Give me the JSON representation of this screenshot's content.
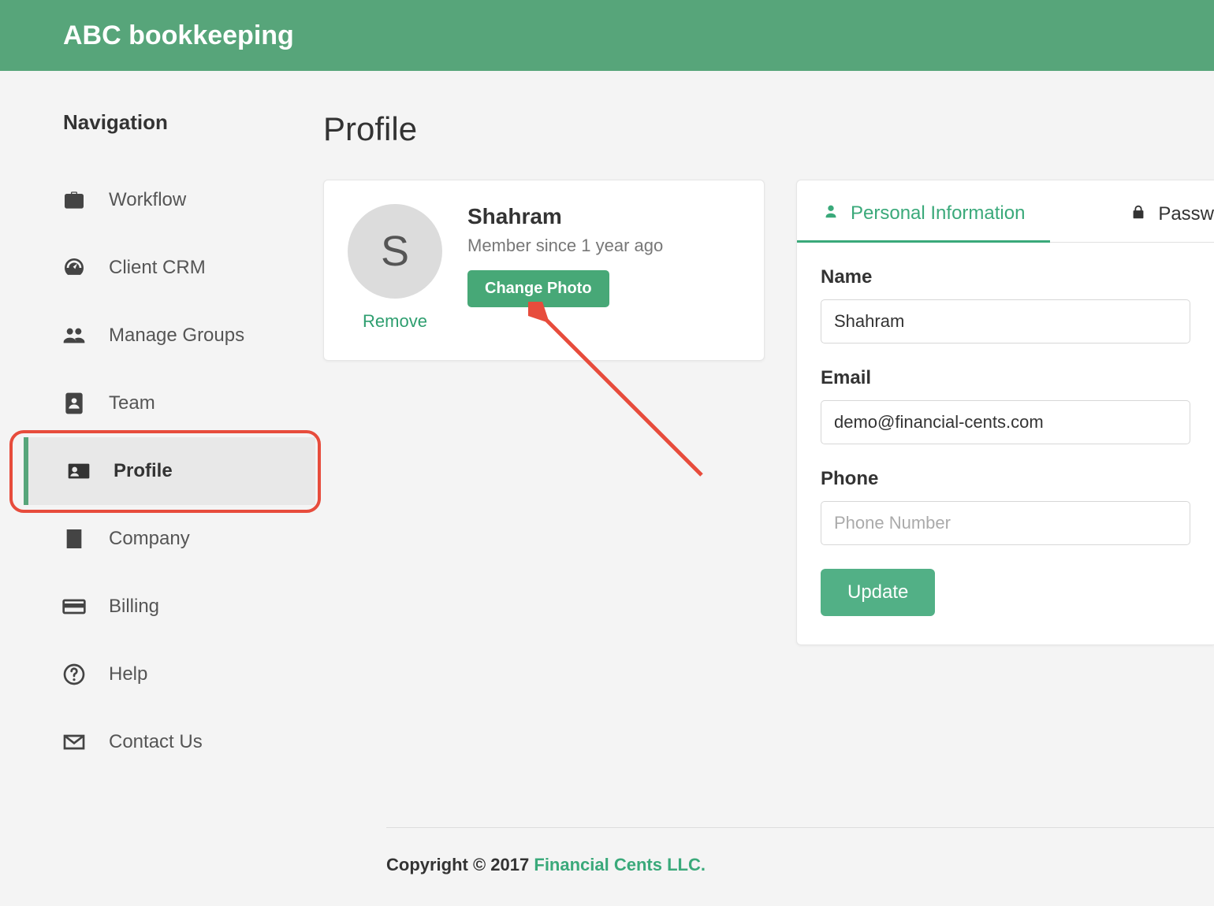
{
  "colors": {
    "primary": "#57a57a",
    "accent": "#3aa97a",
    "danger": "#e74c3c"
  },
  "topbar": {
    "title": "ABC bookkeeping"
  },
  "sidebar": {
    "title": "Navigation",
    "items": [
      {
        "label": "Workflow",
        "icon": "briefcase",
        "active": false
      },
      {
        "label": "Client CRM",
        "icon": "dashboard",
        "active": false
      },
      {
        "label": "Manage Groups",
        "icon": "users",
        "active": false
      },
      {
        "label": "Team",
        "icon": "addressbook",
        "active": false
      },
      {
        "label": "Profile",
        "icon": "id-card",
        "active": true
      },
      {
        "label": "Company",
        "icon": "building",
        "active": false
      },
      {
        "label": "Billing",
        "icon": "card",
        "active": false
      },
      {
        "label": "Help",
        "icon": "help",
        "active": false
      },
      {
        "label": "Contact Us",
        "icon": "envelope",
        "active": false
      }
    ]
  },
  "page": {
    "title": "Profile"
  },
  "profile_card": {
    "avatar_initial": "S",
    "name": "Shahram",
    "member_line": "Member since 1 year ago",
    "change_photo_label": "Change Photo",
    "remove_label": "Remove"
  },
  "form": {
    "tabs": [
      {
        "label": "Personal Information",
        "icon": "user",
        "active": true
      },
      {
        "label": "Passw",
        "icon": "lock",
        "active": false
      }
    ],
    "fields": {
      "name": {
        "label": "Name",
        "value": "Shahram",
        "placeholder": ""
      },
      "email": {
        "label": "Email",
        "value": "demo@financial-cents.com",
        "placeholder": ""
      },
      "phone": {
        "label": "Phone",
        "value": "",
        "placeholder": "Phone Number"
      }
    },
    "submit_label": "Update"
  },
  "footer": {
    "copyright_prefix": "Copyright © 2017 ",
    "brand": "Financial Cents LLC."
  }
}
